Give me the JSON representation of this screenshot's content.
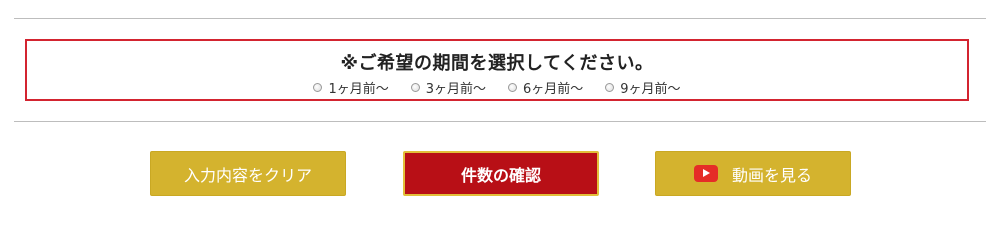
{
  "period_selector": {
    "title": "※ご希望の期間を選択してください。",
    "options": [
      {
        "label": "1ヶ月前〜",
        "selected": false
      },
      {
        "label": "3ヶ月前〜",
        "selected": false
      },
      {
        "label": "6ヶ月前〜",
        "selected": false
      },
      {
        "label": "9ヶ月前〜",
        "selected": false
      }
    ],
    "border_color": "#d32430"
  },
  "buttons": {
    "clear_label": "入力内容をクリア",
    "confirm_label": "件数の確認",
    "video_label": "動画を見る",
    "gold_color": "#d4b32e",
    "confirm_color": "#b80f16"
  },
  "icons": {
    "video": "youtube-play-icon",
    "radio": "radio-button"
  }
}
